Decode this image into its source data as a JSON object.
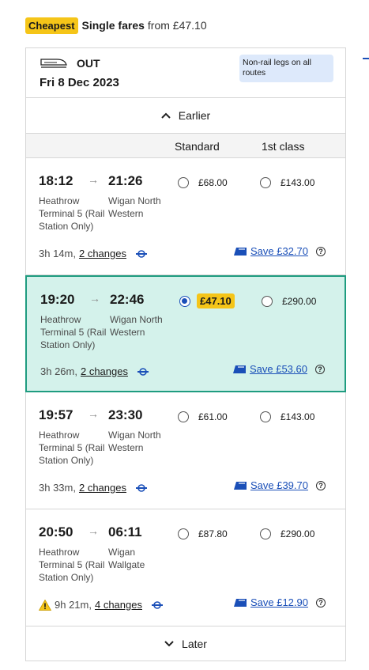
{
  "summary": {
    "badge": "Cheapest",
    "label": "Single fares",
    "from": "from £47.10"
  },
  "out": {
    "label": "OUT",
    "date": "Fri 8 Dec 2023",
    "note": "Non-rail legs on all routes"
  },
  "earlier_label": "Earlier",
  "later_label": "Later",
  "columns": {
    "standard": "Standard",
    "first": "1st class"
  },
  "journeys": [
    {
      "dep": "18:12",
      "arr": "21:26",
      "dep_station": "Heathrow Terminal 5 (Rail Station Only)",
      "arr_station": "Wigan North Western",
      "std_price": "£68.00",
      "first_price": "£143.00",
      "duration": "3h 14m,",
      "changes": "2 changes",
      "save": "Save £32.70"
    },
    {
      "dep": "19:20",
      "arr": "22:46",
      "dep_station": "Heathrow Terminal 5 (Rail Station Only)",
      "arr_station": "Wigan North Western",
      "std_price": "£47.10",
      "first_price": "£290.00",
      "duration": "3h 26m,",
      "changes": "2 changes",
      "save": "Save £53.60"
    },
    {
      "dep": "19:57",
      "arr": "23:30",
      "dep_station": "Heathrow Terminal 5 (Rail Station Only)",
      "arr_station": "Wigan North Western",
      "std_price": "£61.00",
      "first_price": "£143.00",
      "duration": "3h 33m,",
      "changes": "2 changes",
      "save": "Save £39.70"
    },
    {
      "dep": "20:50",
      "arr": "06:11",
      "dep_station": "Heathrow Terminal 5 (Rail Station Only)",
      "arr_station": "Wigan Wallgate",
      "std_price": "£87.80",
      "first_price": "£290.00",
      "duration": "9h 21m,",
      "changes": "4 changes",
      "save": "Save £12.90"
    }
  ],
  "colors": {
    "selected_bg": "#d4f2eb",
    "selected_border": "#1f9c80",
    "badge": "#f5c518",
    "link": "#1a4fb8"
  }
}
